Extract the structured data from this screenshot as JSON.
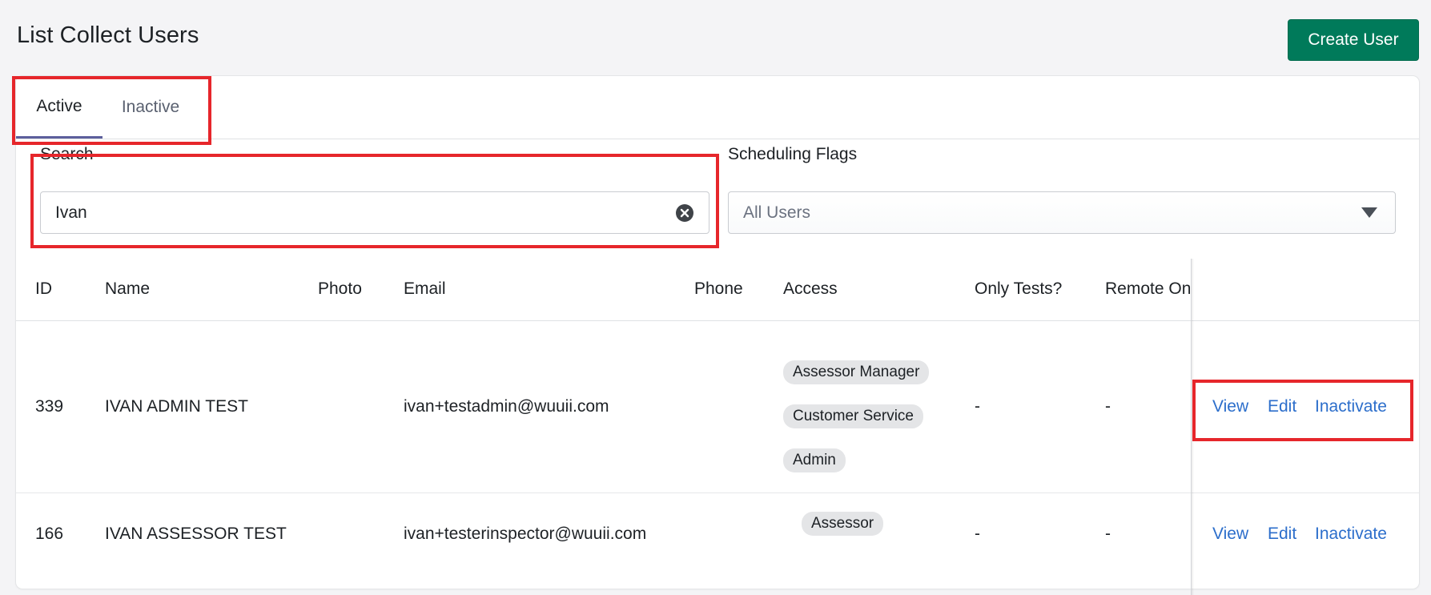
{
  "page": {
    "title": "List Collect Users",
    "create_button": "Create User"
  },
  "tabs": [
    {
      "label": "Active",
      "active": true
    },
    {
      "label": "Inactive",
      "active": false
    }
  ],
  "filters": {
    "search": {
      "label": "Search",
      "value": "Ivan"
    },
    "scheduling_flags": {
      "label": "Scheduling Flags",
      "selected": "All Users"
    }
  },
  "table": {
    "columns": [
      "ID",
      "Name",
      "Photo",
      "Email",
      "Phone",
      "Access",
      "Only Tests?",
      "Remote On"
    ],
    "rows": [
      {
        "id": "339",
        "name": "IVAN ADMIN TEST",
        "photo": "",
        "email": "ivan+testadmin@wuuii.com",
        "phone": "",
        "access": [
          "Assessor Manager",
          "Customer Service",
          "Admin"
        ],
        "only_tests": "-",
        "remote_only": "-",
        "actions": [
          "View",
          "Edit",
          "Inactivate"
        ]
      },
      {
        "id": "166",
        "name": "IVAN ASSESSOR TEST",
        "photo": "",
        "email": "ivan+testerinspector@wuuii.com",
        "phone": "",
        "access": [
          "Assessor"
        ],
        "only_tests": "-",
        "remote_only": "-",
        "actions": [
          "View",
          "Edit",
          "Inactivate"
        ]
      }
    ]
  },
  "colors": {
    "primary_button": "#007a5a",
    "link": "#2c6ecb",
    "active_tab_underline": "#5c5f9c",
    "annotation_box": "#e6262b"
  },
  "icons": {
    "search_clear": "close-circle-icon",
    "select_caret": "caret-down-icon"
  }
}
